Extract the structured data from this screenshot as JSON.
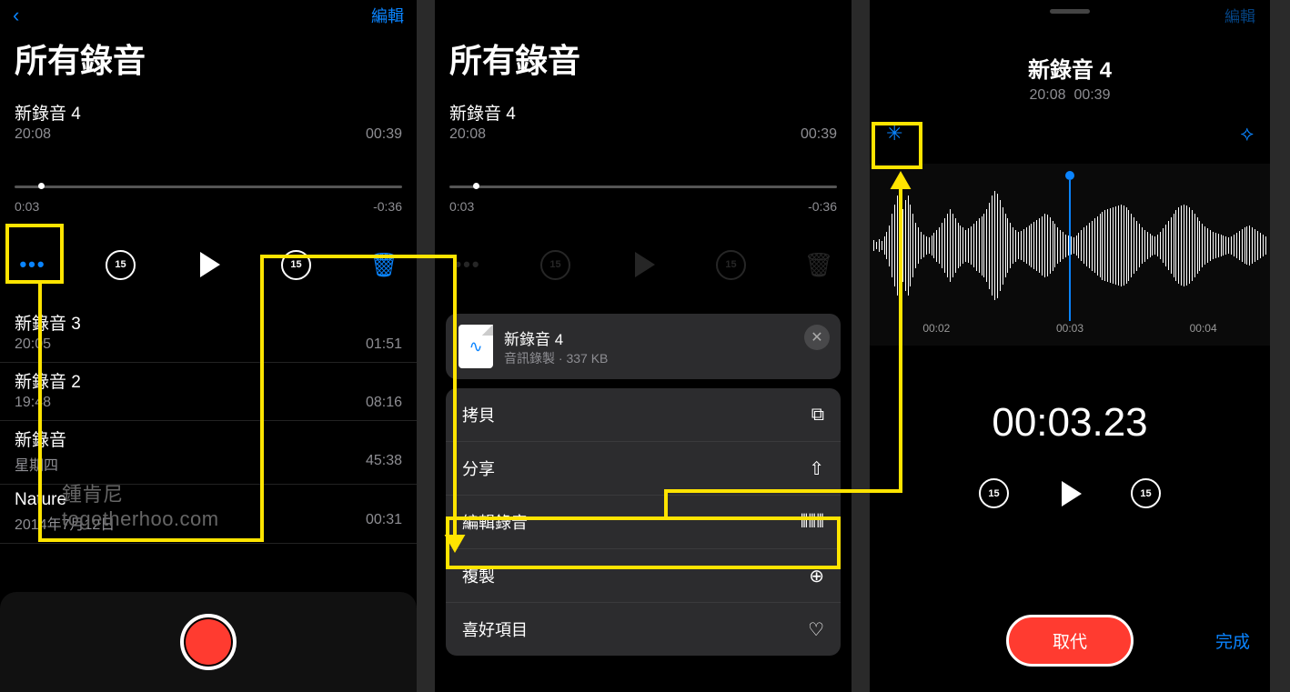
{
  "screen1": {
    "nav_edit": "編輯",
    "title": "所有錄音",
    "expanded": {
      "title": "新錄音 4",
      "time": "20:08",
      "duration": "00:39",
      "pos": "0:03",
      "remaining": "-0:36"
    },
    "skip_back": "15",
    "skip_fwd": "15",
    "recordings": [
      {
        "title": "新錄音 3",
        "time": "20:05",
        "duration": "01:51"
      },
      {
        "title": "新錄音 2",
        "time": "19:48",
        "duration": "08:16"
      },
      {
        "title": "新錄音",
        "time": "星期四",
        "duration": "45:38"
      },
      {
        "title": "Nature",
        "time": "2014年7月12日",
        "duration": "00:31"
      }
    ]
  },
  "screen2": {
    "title": "所有錄音",
    "expanded": {
      "title": "新錄音 4",
      "time": "20:08",
      "duration": "00:39",
      "pos": "0:03",
      "remaining": "-0:36"
    },
    "share": {
      "file_title": "新錄音 4",
      "file_sub": "音訊錄製 · 337 KB",
      "items": {
        "copy": "拷貝",
        "share": "分享",
        "edit": "編輯錄音",
        "duplicate": "複製",
        "favorite": "喜好項目"
      }
    }
  },
  "screen3": {
    "nav_edit": "編輯",
    "title": "新錄音 4",
    "sub_time": "20:08",
    "sub_dur": "00:39",
    "ticks": [
      "00:02",
      "00:03",
      "00:04"
    ],
    "big_time": "00:03.23",
    "skip_back": "15",
    "skip_fwd": "15",
    "replace": "取代",
    "done": "完成"
  },
  "watermark": {
    "line1": "鍾肯尼",
    "line2": "togetherhoo.com"
  }
}
